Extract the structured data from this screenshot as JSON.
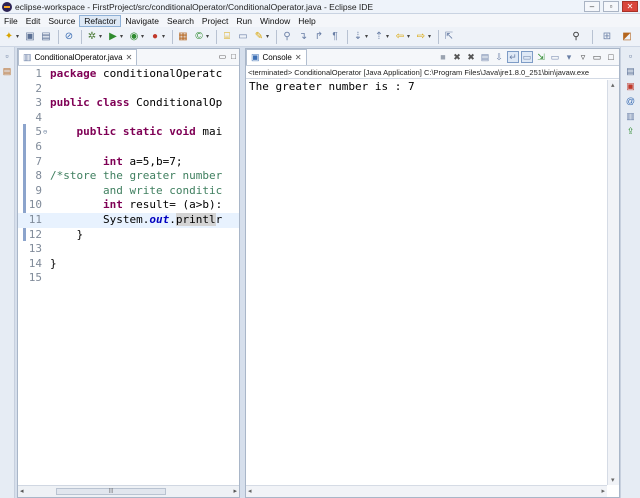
{
  "window": {
    "title": "eclipse-workspace - FirstProject/src/conditionalOperator/ConditionalOperator.java - Eclipse IDE",
    "controls": [
      "–",
      "▫",
      "✕"
    ]
  },
  "menu": [
    "File",
    "Edit",
    "Source",
    "Refactor",
    "Navigate",
    "Search",
    "Project",
    "Run",
    "Window",
    "Help"
  ],
  "active_menu_index": 3,
  "editor": {
    "tab_label": "ConditionalOperator.java",
    "tab_close": "✕",
    "min": "▭",
    "max": "□",
    "lines": [
      {
        "n": "1",
        "segs": [
          {
            "t": "package",
            "c": "kw"
          },
          {
            "t": " conditionalOperatc",
            "c": ""
          }
        ]
      },
      {
        "n": "2",
        "segs": []
      },
      {
        "n": "3",
        "segs": [
          {
            "t": "public",
            "c": "kw"
          },
          {
            "t": " ",
            "c": ""
          },
          {
            "t": "class",
            "c": "kw"
          },
          {
            "t": " ConditionalOp",
            "c": ""
          }
        ]
      },
      {
        "n": "4",
        "segs": []
      },
      {
        "n": "5",
        "segs": [
          {
            "t": "    ",
            "c": ""
          },
          {
            "t": "public",
            "c": "kw"
          },
          {
            "t": " ",
            "c": ""
          },
          {
            "t": "static",
            "c": "kw"
          },
          {
            "t": " ",
            "c": ""
          },
          {
            "t": "void",
            "c": "kw"
          },
          {
            "t": " mai",
            "c": ""
          }
        ],
        "fold": "⊖"
      },
      {
        "n": "6",
        "segs": []
      },
      {
        "n": "7",
        "segs": [
          {
            "t": "        ",
            "c": ""
          },
          {
            "t": "int",
            "c": "kw"
          },
          {
            "t": " a=5,b=7;",
            "c": ""
          }
        ]
      },
      {
        "n": "8",
        "segs": [
          {
            "t": "/*store the greater number",
            "c": "cm"
          }
        ]
      },
      {
        "n": "9",
        "segs": [
          {
            "t": "        and write conditic",
            "c": "cm"
          }
        ]
      },
      {
        "n": "10",
        "segs": [
          {
            "t": "        ",
            "c": ""
          },
          {
            "t": "int",
            "c": "kw"
          },
          {
            "t": " result= (a>b):",
            "c": ""
          }
        ]
      },
      {
        "n": "11",
        "segs": [
          {
            "t": "        System.",
            "c": ""
          },
          {
            "t": "out",
            "c": "fld"
          },
          {
            "t": ".",
            "c": ""
          },
          {
            "t": "print",
            "c": "hl"
          },
          {
            "t": "l",
            "c": "hl"
          },
          {
            "t": "r",
            "c": ""
          }
        ],
        "current": true
      },
      {
        "n": "12",
        "segs": [
          {
            "t": "    }",
            "c": ""
          }
        ]
      },
      {
        "n": "13",
        "segs": []
      },
      {
        "n": "14",
        "segs": [
          {
            "t": "}",
            "c": ""
          }
        ]
      },
      {
        "n": "15",
        "segs": []
      }
    ],
    "scroll_thumb": "|||"
  },
  "console": {
    "tab_label": "Console",
    "tab_close": "✕",
    "status": "<terminated> ConditionalOperator [Java Application] C:\\Program Files\\Java\\jre1.8.0_251\\bin\\javaw.exe",
    "output": "The greater number is : 7"
  }
}
